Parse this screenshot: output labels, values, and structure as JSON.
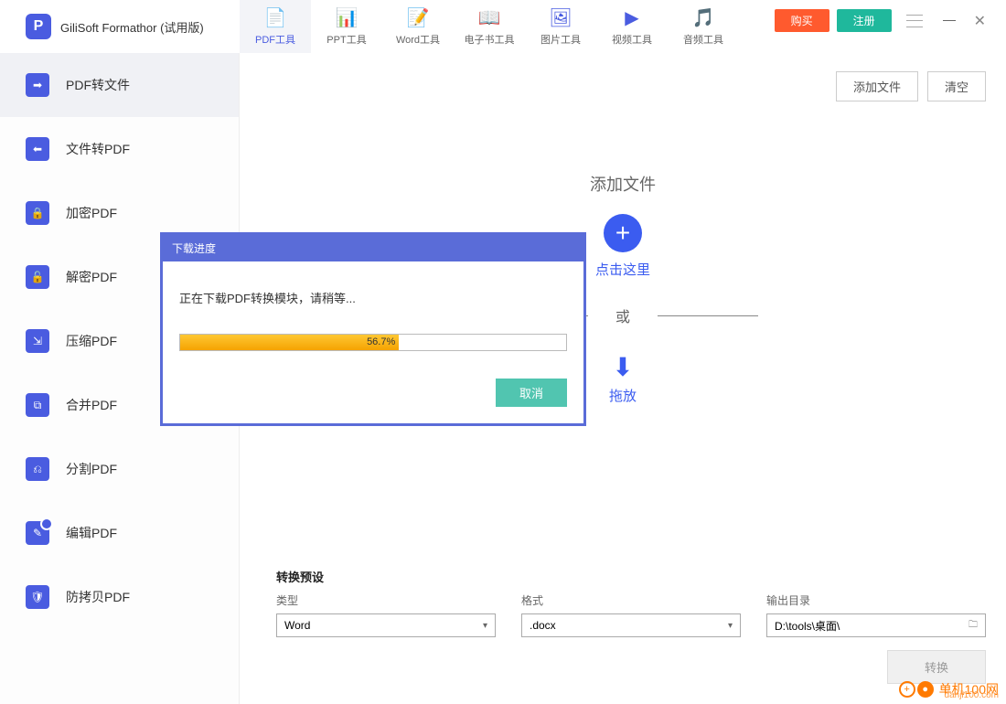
{
  "app": {
    "title": "GiliSoft Formathor (试用版)"
  },
  "topTabs": [
    {
      "label": "PDF工具"
    },
    {
      "label": "PPT工具"
    },
    {
      "label": "Word工具"
    },
    {
      "label": "电子书工具"
    },
    {
      "label": "图片工具"
    },
    {
      "label": "视频工具"
    },
    {
      "label": "音频工具"
    }
  ],
  "winButtons": {
    "buy": "购买",
    "register": "注册"
  },
  "sidebar": [
    {
      "label": "PDF转文件"
    },
    {
      "label": "文件转PDF"
    },
    {
      "label": "加密PDF"
    },
    {
      "label": "解密PDF"
    },
    {
      "label": "压缩PDF"
    },
    {
      "label": "合并PDF"
    },
    {
      "label": "分割PDF"
    },
    {
      "label": "编辑PDF"
    },
    {
      "label": "防拷贝PDF"
    }
  ],
  "actions": {
    "addFile": "添加文件",
    "clear": "清空"
  },
  "dropzone": {
    "title": "添加文件",
    "click": "点击这里",
    "or": "或",
    "drop": "拖放"
  },
  "preset": {
    "title": "转换预设",
    "typeLabel": "类型",
    "typeValue": "Word",
    "formatLabel": "格式",
    "formatValue": ".docx",
    "outdirLabel": "输出目录",
    "outdirValue": "D:\\tools\\桌面\\",
    "convert": "转换"
  },
  "modal": {
    "title": "下载进度",
    "text": "正在下载PDF转换模块，请稍等...",
    "percent": "56.7%",
    "percentValue": 56.7,
    "cancel": "取消"
  },
  "watermark": {
    "text": "单机100网",
    "url": "danji100.com"
  }
}
